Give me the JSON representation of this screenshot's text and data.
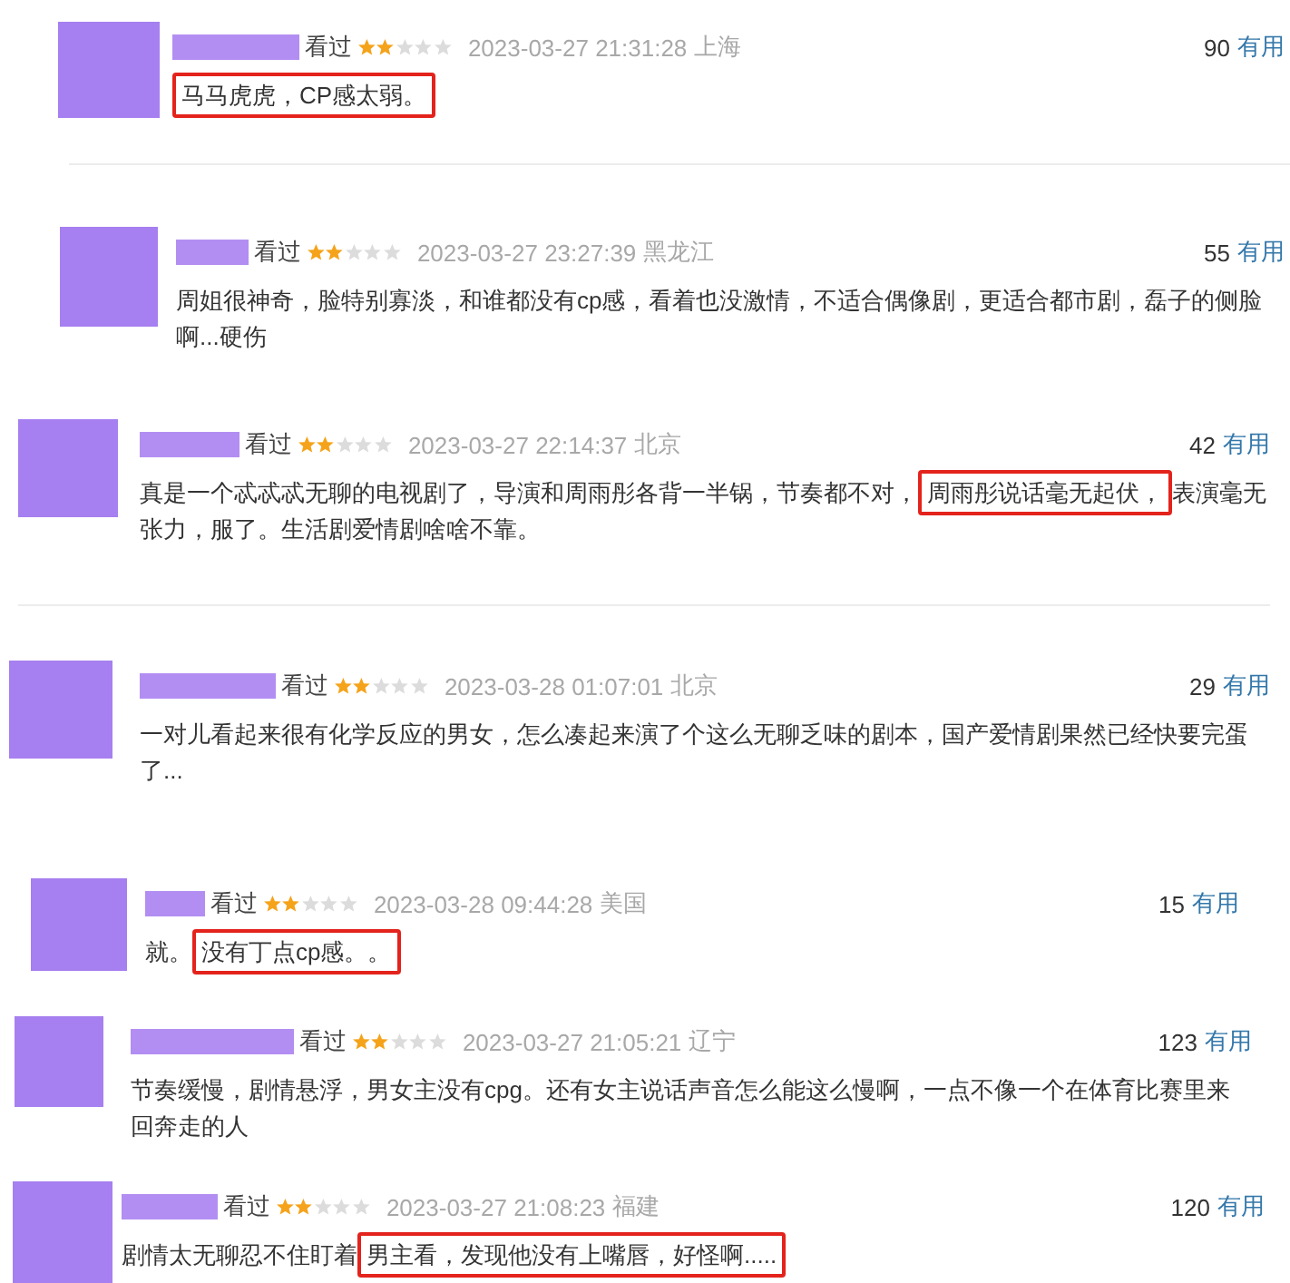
{
  "reviews": [
    {
      "status": "看过",
      "stars": 2,
      "time": "2023-03-27 21:31:28",
      "location": "上海",
      "useful_count": "90",
      "useful_label": "有用",
      "text": [
        {
          "content": "马马虎虎，CP感太弱。",
          "highlighted": true
        }
      ]
    },
    {
      "status": "看过",
      "stars": 2,
      "time": "2023-03-27 23:27:39",
      "location": "黑龙江",
      "useful_count": "55",
      "useful_label": "有用",
      "text": [
        {
          "content": "周姐很神奇，脸特别寡淡，和谁都没有cp感，看着也没激情，不适合偶像剧，更适合都市剧，磊子的侧脸啊...硬伤",
          "highlighted": false
        }
      ]
    },
    {
      "status": "看过",
      "stars": 2,
      "time": "2023-03-27 22:14:37",
      "location": "北京",
      "useful_count": "42",
      "useful_label": "有用",
      "text": [
        {
          "content": "真是一个忒忒忒无聊的电视剧了，导演和周雨彤各背一半锅，节奏都不对，",
          "highlighted": false
        },
        {
          "content": "周雨彤说话毫无起伏，",
          "highlighted": true
        },
        {
          "content": "表演毫无张力，服了。生活剧爱情剧啥啥不靠。",
          "highlighted": false
        }
      ]
    },
    {
      "status": "看过",
      "stars": 2,
      "time": "2023-03-28 01:07:01",
      "location": "北京",
      "useful_count": "29",
      "useful_label": "有用",
      "text": [
        {
          "content": "一对儿看起来很有化学反应的男女，怎么凑起来演了个这么无聊乏味的剧本，国产爱情剧果然已经快要完蛋了...",
          "highlighted": false
        }
      ]
    },
    {
      "status": "看过",
      "stars": 2,
      "time": "2023-03-28 09:44:28",
      "location": "美国",
      "useful_count": "15",
      "useful_label": "有用",
      "text": [
        {
          "content": "就。",
          "highlighted": false
        },
        {
          "content": "没有丁点cp感。。",
          "highlighted": true
        }
      ]
    },
    {
      "status": "看过",
      "stars": 2,
      "time": "2023-03-27 21:05:21",
      "location": "辽宁",
      "useful_count": "123",
      "useful_label": "有用",
      "text": [
        {
          "content": "节奏缓慢，剧情悬浮，男女主没有cpg。还有女主说话声音怎么能这么慢啊，一点不像一个在体育比赛里来回奔走的人",
          "highlighted": false
        }
      ]
    },
    {
      "status": "看过",
      "stars": 2,
      "time": "2023-03-27 21:08:23",
      "location": "福建",
      "useful_count": "120",
      "useful_label": "有用",
      "text": [
        {
          "content": "剧情太无聊忍不住盯着",
          "highlighted": false
        },
        {
          "content": "男主看，发现他没有上嘴唇，好怪啊.....",
          "highlighted": true
        }
      ]
    }
  ]
}
